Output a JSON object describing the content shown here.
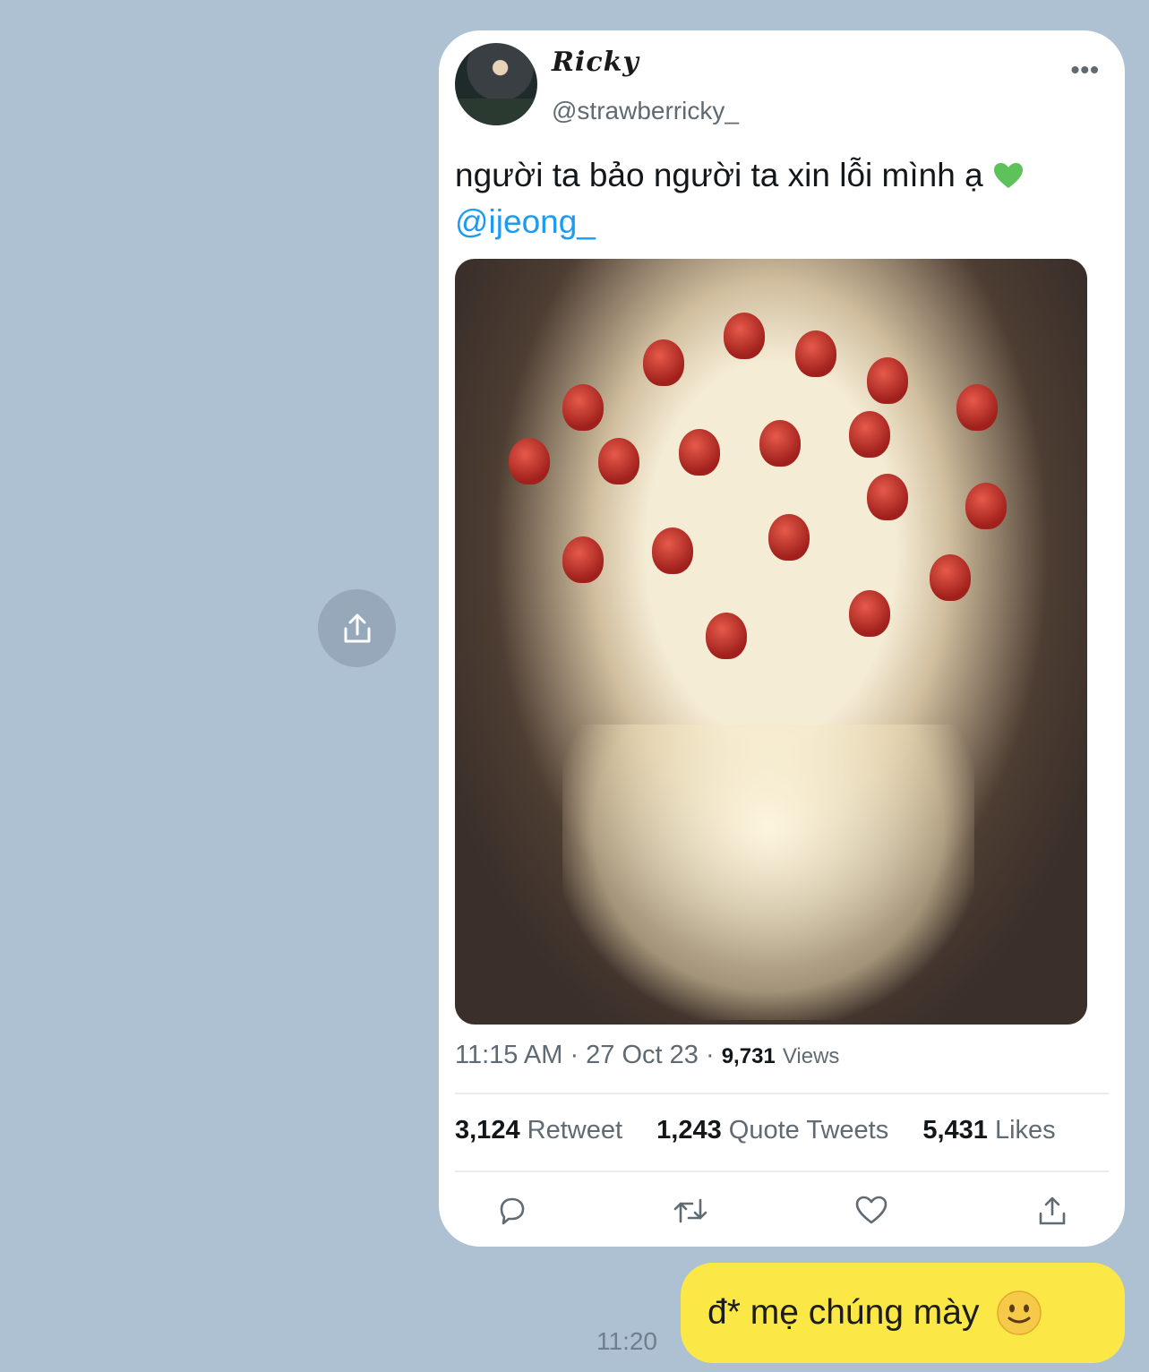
{
  "tweet": {
    "display_name": "Ricky",
    "handle": "@strawberricky_",
    "more_icon": "•••",
    "text": "người ta bảo người ta xin lỗi mình ạ",
    "emoji": "green-heart",
    "mention": "@ijeong_",
    "time": "11:15 AM",
    "date": "27 Oct 23",
    "views_count": "9,731",
    "views_label": "Views",
    "retweet_count": "3,124",
    "retweet_label": "Retweet",
    "quote_count": "1,243",
    "quote_label": "Quote Tweets",
    "likes_count": "5,431",
    "likes_label": "Likes",
    "actions": [
      "reply-icon",
      "retweet-icon",
      "like-icon",
      "share-icon"
    ]
  },
  "message": {
    "text": "đ* mẹ chúng mày",
    "emoji": "slightly-smiling-face",
    "time": "11:20"
  },
  "colors": {
    "background": "#aec1d3",
    "bubble": "#fbe746",
    "mention": "#1d9bf0",
    "heart": "#5dc25a"
  }
}
